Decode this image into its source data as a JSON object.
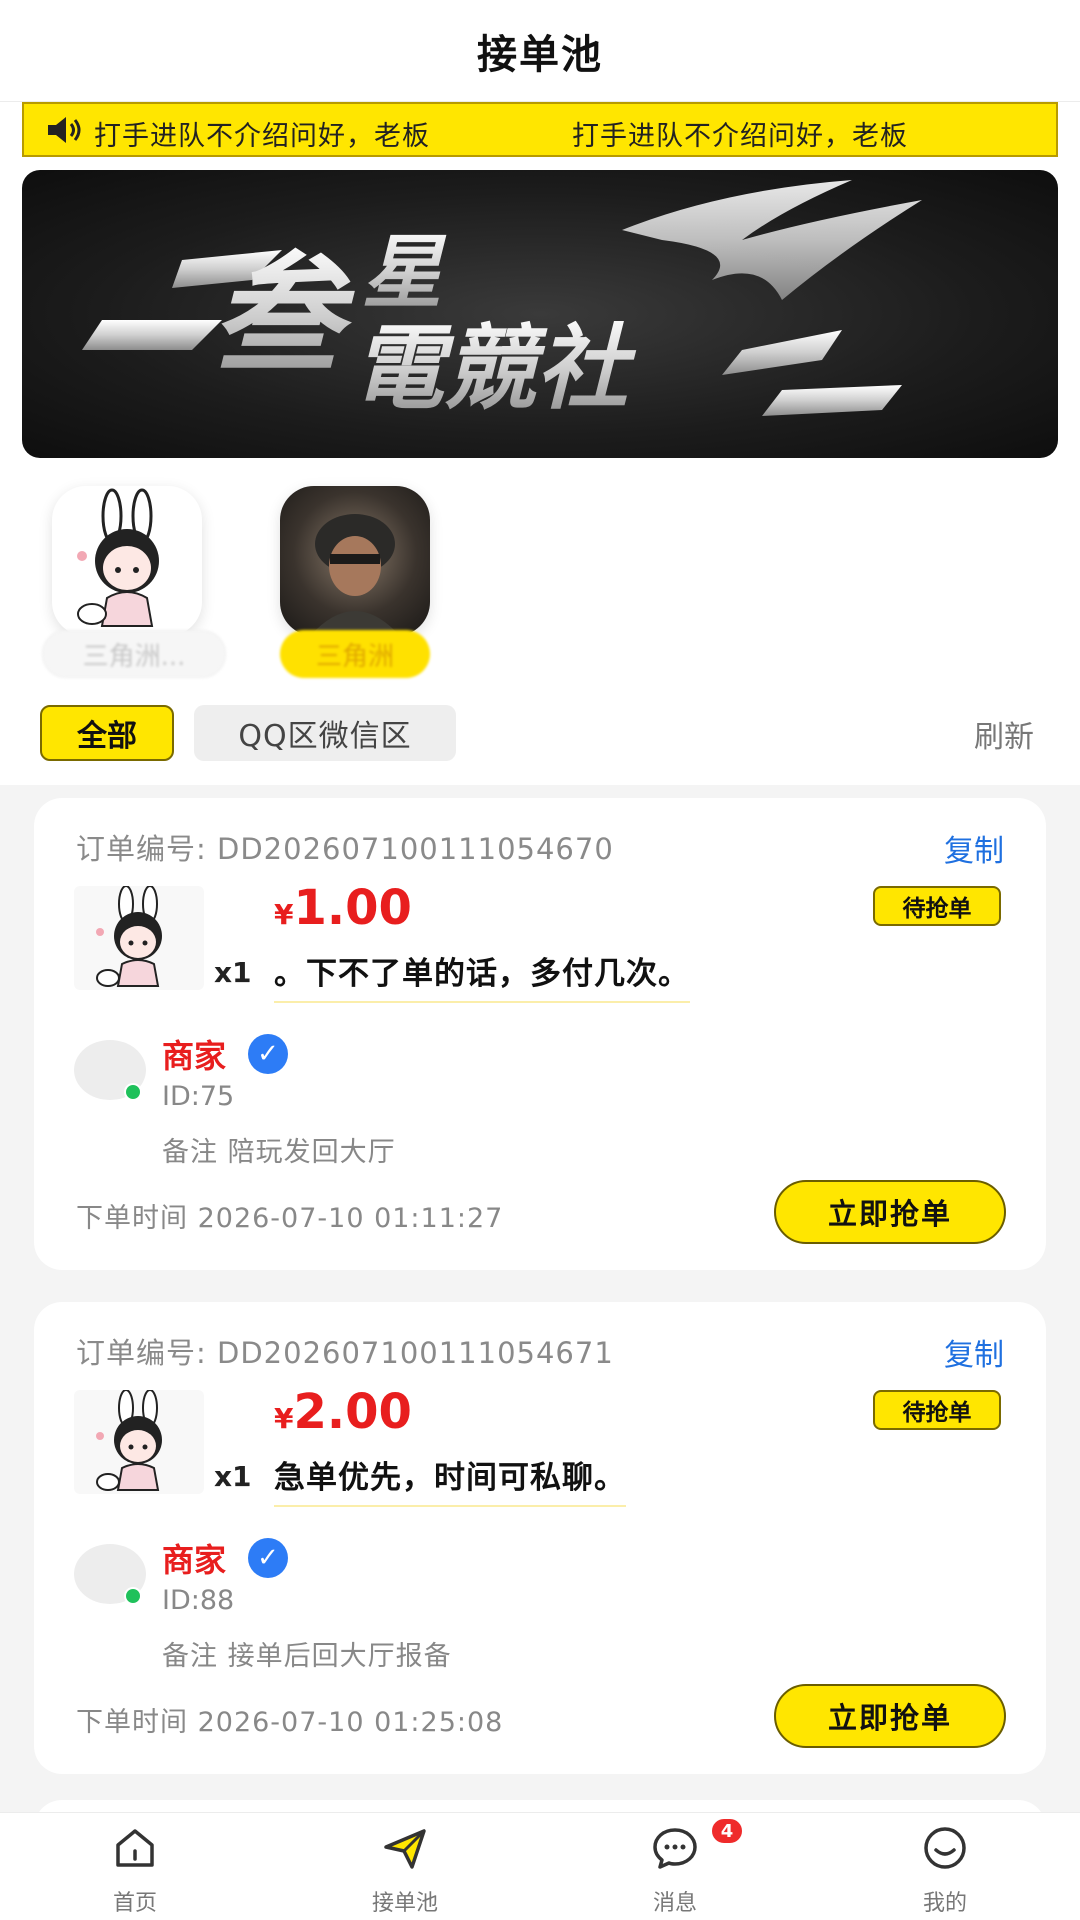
{
  "header": {
    "title": "接单池"
  },
  "notice": {
    "messages": [
      "打手进队不介绍问好，老板",
      "打手进队不介绍问好，老板"
    ]
  },
  "banner": {
    "logo_text": "叁星電競社"
  },
  "games": [
    {
      "name": "三角洲...",
      "selected": false
    },
    {
      "name": "三角洲",
      "selected": true
    }
  ],
  "filters": {
    "all_label": "全部",
    "zone_label": "QQ区微信区",
    "refresh_label": "刷新"
  },
  "orders": [
    {
      "order_label": "订单编号:",
      "order_no": "DD202607100111054670",
      "copy_label": "复制",
      "currency": "¥",
      "price": "1.00",
      "qty": "x1",
      "desc": "。下不了单的话，多付几次。",
      "status": "待抢单",
      "merchant": "商家",
      "uid": "ID:75",
      "remark": "备注 陪玩发回大厅",
      "time": "下单时间 2026-07-10 01:11:27",
      "action": "立即抢单"
    },
    {
      "order_label": "订单编号:",
      "order_no": "DD202607100111054671",
      "copy_label": "复制",
      "currency": "¥",
      "price": "2.00",
      "qty": "x1",
      "desc": "急单优先，时间可私聊。",
      "status": "待抢单",
      "merchant": "商家",
      "uid": "ID:88",
      "remark": "备注 接单后回大厅报备",
      "time": "下单时间 2026-07-10 01:25:08",
      "action": "立即抢单"
    }
  ],
  "tabbar": {
    "items": [
      {
        "label": "首页",
        "icon": "home-icon"
      },
      {
        "label": "接单池",
        "icon": "send-icon"
      },
      {
        "label": "消息",
        "icon": "chat-icon",
        "badge": "4"
      },
      {
        "label": "我的",
        "icon": "smile-icon"
      }
    ]
  },
  "colors": {
    "accent": "#ffe600",
    "price": "#e81e1e",
    "link": "#1f70e0",
    "online": "#1fc15b"
  }
}
